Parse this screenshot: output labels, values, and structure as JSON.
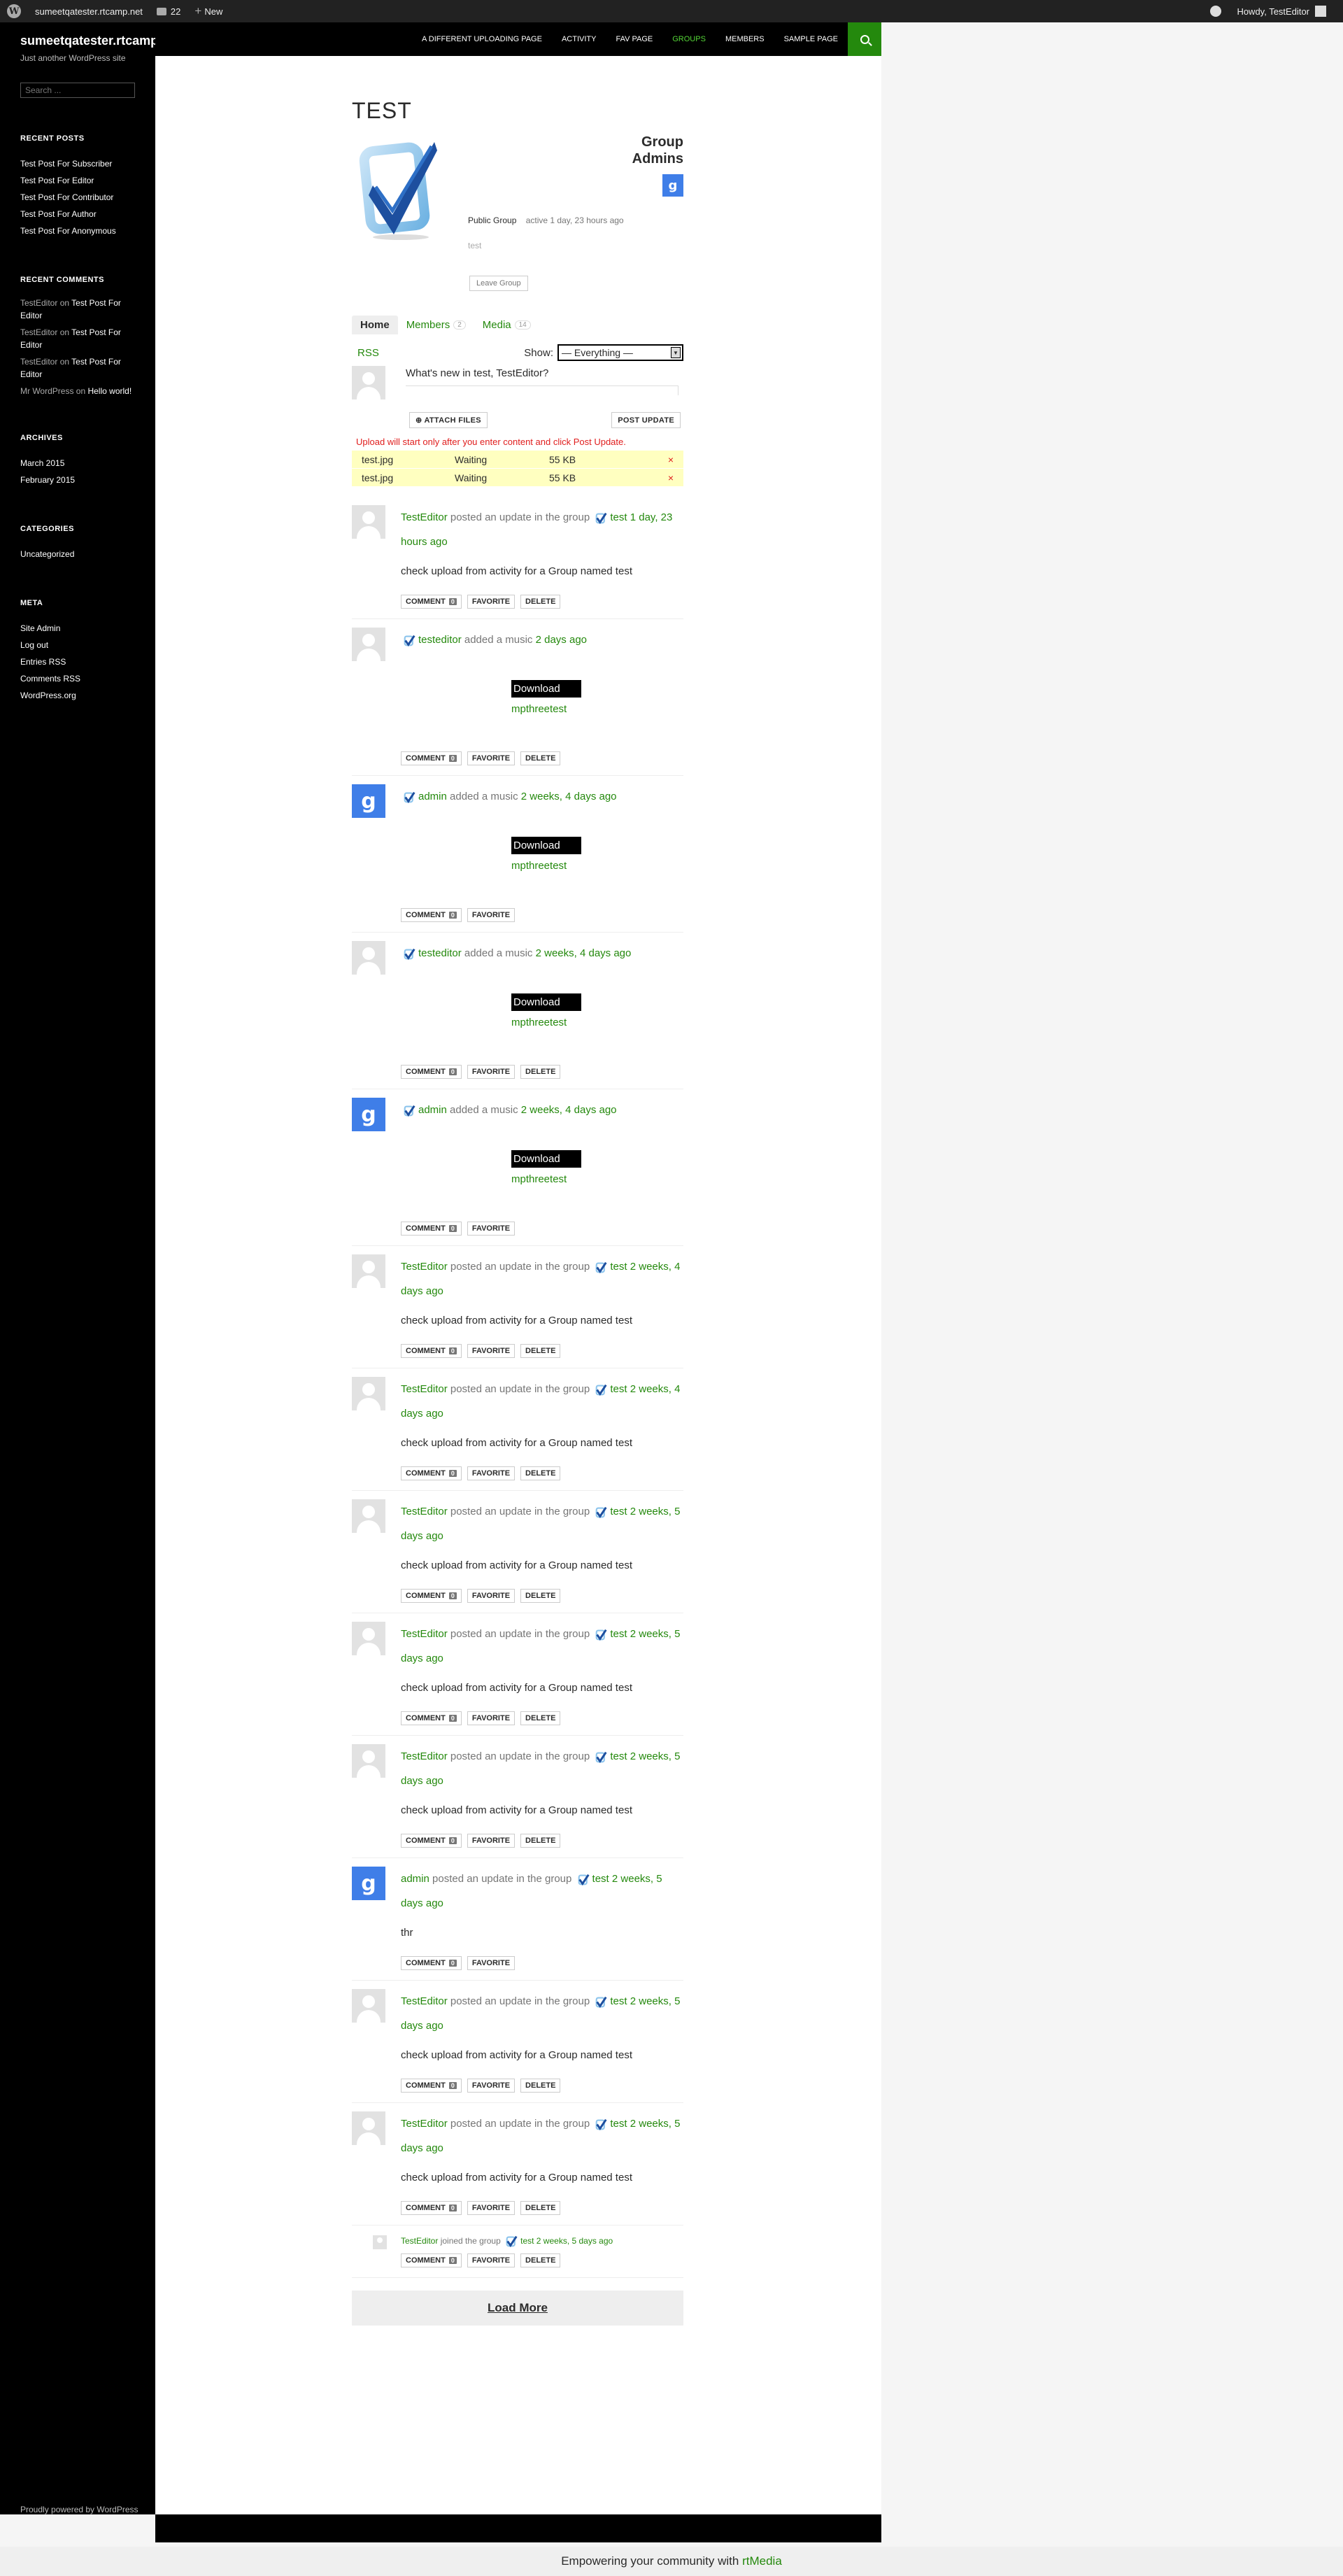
{
  "adminbar": {
    "site_name": "sumeetqatester.rtcamp.net",
    "comments_count": "22",
    "new_label": "New",
    "howdy": "Howdy, TestEditor"
  },
  "site": {
    "title": "sumeetqatester.rtcamp.net",
    "description": "Just another WordPress site",
    "search_placeholder": "Search ...",
    "powered": "Proudly powered by WordPress"
  },
  "nav": {
    "items": [
      {
        "label": "A DIFFERENT UPLOADING PAGE"
      },
      {
        "label": "ACTIVITY"
      },
      {
        "label": "FAV PAGE"
      },
      {
        "label": "GROUPS"
      },
      {
        "label": "MEMBERS"
      },
      {
        "label": "SAMPLE PAGE"
      }
    ],
    "active_color": "#55d737"
  },
  "widgets": {
    "recent_posts_title": "RECENT POSTS",
    "recent_posts": [
      "Test Post For Subscriber",
      "Test Post For Editor",
      "Test Post For Contributor",
      "Test Post For Author",
      "Test Post For Anonymous"
    ],
    "recent_comments_title": "RECENT COMMENTS",
    "recent_comments": [
      {
        "author": "TestEditor",
        "on": "on",
        "post": "Test Post For Editor"
      },
      {
        "author": "TestEditor",
        "on": "on",
        "post": "Test Post For Editor"
      },
      {
        "author": "TestEditor",
        "on": "on",
        "post": "Test Post For Editor"
      },
      {
        "author": "Mr WordPress",
        "on": "on",
        "post": "Hello world!"
      }
    ],
    "archives_title": "ARCHIVES",
    "archives": [
      "March 2015",
      "February 2015"
    ],
    "categories_title": "CATEGORIES",
    "categories": [
      "Uncategorized"
    ],
    "meta_title": "META",
    "meta": [
      "Site Admin",
      "Log out",
      "Entries RSS",
      "Comments RSS",
      "WordPress.org"
    ]
  },
  "group": {
    "title": "TEST",
    "admins_label": "Group Admins",
    "status": "Public Group",
    "active": "active 1 day, 23 hours ago",
    "description": "test",
    "leave_label": "Leave Group"
  },
  "tabs": [
    {
      "label": "Home",
      "count": ""
    },
    {
      "label": "Members",
      "count": "2"
    },
    {
      "label": "Media",
      "count": "14"
    }
  ],
  "filter": {
    "rss": "RSS",
    "show_label": "Show:",
    "selected": "— Everything —"
  },
  "post_form": {
    "prompt": "What's new in test, TestEditor?",
    "attach_label": "ATTACH FILES",
    "post_label": "POST UPDATE",
    "upload_note": "Upload will start only after you enter content and click Post Update.",
    "queue": [
      {
        "name": "test.jpg",
        "status": "Waiting",
        "size": "55 KB",
        "remove": "×"
      },
      {
        "name": "test.jpg",
        "status": "Waiting",
        "size": "55 KB",
        "remove": "×"
      }
    ]
  },
  "activity": {
    "comment_label": "COMMENT",
    "favorite_label": "FAVORITE",
    "delete_label": "DELETE",
    "comment_count": "0",
    "download_label": "Download",
    "items": [
      {
        "kind": "update",
        "avatar": "grey",
        "user": "TestEditor",
        "action": "posted an update in the group",
        "group": "test",
        "time": "1 day, 23 hours ago",
        "content": "check upload from activity for a Group named test",
        "deletable": true
      },
      {
        "kind": "music",
        "avatar": "grey",
        "user": "testeditor",
        "action": "added a music",
        "time": "2 days ago",
        "music": "mpthreetest",
        "deletable": true
      },
      {
        "kind": "music",
        "avatar": "google",
        "user": "admin",
        "action": "added a music",
        "time": "2 weeks, 4 days ago",
        "music": "mpthreetest",
        "deletable": false
      },
      {
        "kind": "music",
        "avatar": "grey",
        "user": "testeditor",
        "action": "added a music",
        "time": "2 weeks, 4 days ago",
        "music": "mpthreetest",
        "deletable": true
      },
      {
        "kind": "music",
        "avatar": "google",
        "user": "admin",
        "action": "added a music",
        "time": "2 weeks, 4 days ago",
        "music": "mpthreetest",
        "deletable": false
      },
      {
        "kind": "update",
        "avatar": "grey",
        "user": "TestEditor",
        "action": "posted an update in the group",
        "group": "test",
        "time": "2 weeks, 4 days ago",
        "content": "check upload from activity for a Group named test",
        "deletable": true
      },
      {
        "kind": "update",
        "avatar": "grey",
        "user": "TestEditor",
        "action": "posted an update in the group",
        "group": "test",
        "time": "2 weeks, 4 days ago",
        "content": "check upload from activity for a Group named test",
        "deletable": true
      },
      {
        "kind": "update",
        "avatar": "grey",
        "user": "TestEditor",
        "action": "posted an update in the group",
        "group": "test",
        "time": "2 weeks, 5 days ago",
        "content": "check upload from activity for a Group named test",
        "deletable": true
      },
      {
        "kind": "update",
        "avatar": "grey",
        "user": "TestEditor",
        "action": "posted an update in the group",
        "group": "test",
        "time": "2 weeks, 5 days ago",
        "content": "check upload from activity for a Group named test",
        "deletable": true
      },
      {
        "kind": "update",
        "avatar": "grey",
        "user": "TestEditor",
        "action": "posted an update in the group",
        "group": "test",
        "time": "2 weeks, 5 days ago",
        "content": "check upload from activity for a Group named test",
        "deletable": true
      },
      {
        "kind": "update",
        "avatar": "google",
        "user": "admin",
        "action": "posted an update in the group",
        "group": "test",
        "time": "2 weeks, 5 days ago",
        "content": "thr",
        "deletable": false
      },
      {
        "kind": "update",
        "avatar": "grey",
        "user": "TestEditor",
        "action": "posted an update in the group",
        "group": "test",
        "time": "2 weeks, 5 days ago",
        "content": "check upload from activity for a Group named test",
        "deletable": true
      },
      {
        "kind": "update",
        "avatar": "grey",
        "user": "TestEditor",
        "action": "posted an update in the group",
        "group": "test",
        "time": "2 weeks, 5 days ago",
        "content": "check upload from activity for a Group named test",
        "deletable": true
      },
      {
        "kind": "joined",
        "avatar": "grey-small",
        "user": "TestEditor",
        "action": "joined the group",
        "group": "test",
        "time": "2 weeks, 5 days ago",
        "deletable": true
      }
    ],
    "load_more": "Load More"
  },
  "footer": {
    "text": "Empowering your community with",
    "link": "rtMedia"
  },
  "colors": {
    "accent": "#24890d",
    "google_blue": "#3f7ee8",
    "queue_bg": "#ffffc0",
    "error": "#e01d1d"
  }
}
